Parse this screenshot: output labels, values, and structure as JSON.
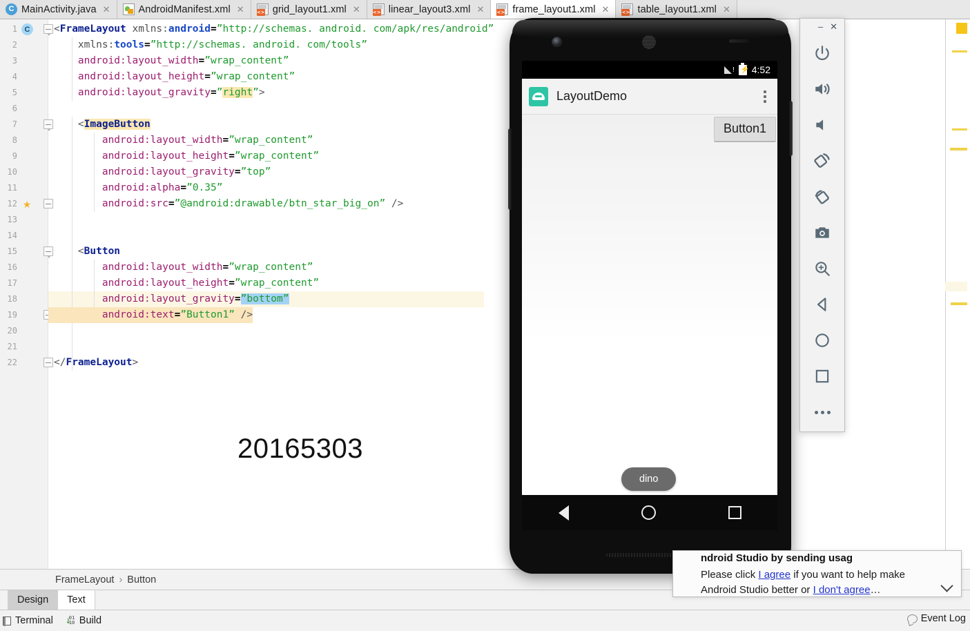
{
  "tabs": [
    {
      "label": "MainActivity.java",
      "icon": "java-class-icon",
      "active": false
    },
    {
      "label": "AndroidManifest.xml",
      "icon": "manifest-icon",
      "active": false
    },
    {
      "label": "grid_layout1.xml",
      "icon": "xml-layout-icon",
      "active": false
    },
    {
      "label": "linear_layout3.xml",
      "icon": "xml-layout-icon",
      "active": false
    },
    {
      "label": "frame_layout1.xml",
      "icon": "xml-layout-icon",
      "active": true
    },
    {
      "label": "table_layout1.xml",
      "icon": "xml-layout-icon",
      "active": false
    }
  ],
  "editor": {
    "line_count": 22,
    "current_line": 18,
    "selection_text": "bottom",
    "gutter_badge_line1": "C",
    "gutter_star_line": 12,
    "lines": [
      {
        "n": 1,
        "text": "<FrameLayout xmlns:android=\"http://schemas. android. com/apk/res/android\""
      },
      {
        "n": 2,
        "text": "    xmlns:tools=\"http://schemas. android. com/tools\""
      },
      {
        "n": 3,
        "text": "    android:layout_width=\"wrap_content\""
      },
      {
        "n": 4,
        "text": "    android:layout_height=\"wrap_content\""
      },
      {
        "n": 5,
        "text": "    android:layout_gravity=\"right\">"
      },
      {
        "n": 6,
        "text": ""
      },
      {
        "n": 7,
        "text": "    <ImageButton"
      },
      {
        "n": 8,
        "text": "        android:layout_width=\"wrap_content\""
      },
      {
        "n": 9,
        "text": "        android:layout_height=\"wrap_content\""
      },
      {
        "n": 10,
        "text": "        android:layout_gravity=\"top\""
      },
      {
        "n": 11,
        "text": "        android:alpha=\"0.35\""
      },
      {
        "n": 12,
        "text": "        android:src=\"@android:drawable/btn_star_big_on\" />"
      },
      {
        "n": 13,
        "text": ""
      },
      {
        "n": 14,
        "text": ""
      },
      {
        "n": 15,
        "text": "    <Button"
      },
      {
        "n": 16,
        "text": "        android:layout_width=\"wrap_content\""
      },
      {
        "n": 17,
        "text": "        android:layout_height=\"wrap_content\""
      },
      {
        "n": 18,
        "text": "        android:layout_gravity=\"bottom\""
      },
      {
        "n": 19,
        "text": "        android:text=\"Button1\" />"
      },
      {
        "n": 20,
        "text": ""
      },
      {
        "n": 21,
        "text": ""
      },
      {
        "n": 22,
        "text": "</FrameLayout>"
      }
    ],
    "watermark": "20165303"
  },
  "breadcrumb": {
    "items": [
      "FrameLayout",
      "Button"
    ],
    "separator": "›"
  },
  "mode_tabs": [
    {
      "label": "Design",
      "active": false
    },
    {
      "label": "Text",
      "active": true
    }
  ],
  "statusbar": {
    "terminal": "Terminal",
    "build": "Build",
    "event_log": "Event Log"
  },
  "emulator": {
    "window_controls": {
      "minimize": "–",
      "close": "✕"
    },
    "toolbar_icons": [
      "power-icon",
      "volume-up-icon",
      "volume-down-icon",
      "rotate-left-icon",
      "rotate-right-icon",
      "screenshot-camera-icon",
      "zoom-icon",
      "back-icon",
      "home-icon",
      "overview-icon",
      "more-icon"
    ],
    "status": {
      "time": "4:52",
      "signal": "signal-warning-icon",
      "battery": "battery-charging-icon"
    },
    "app": {
      "title": "LayoutDemo",
      "logo": "android-app-icon",
      "overflow": "kebab-menu-icon"
    },
    "content": {
      "image_button": "star-image-button",
      "image_button_alpha": "0.35",
      "button1_label": "Button1",
      "toast_text": "dino"
    },
    "navbar": [
      "back-triangle-icon",
      "home-circle-icon",
      "recents-square-icon"
    ]
  },
  "notification": {
    "title": "ndroid Studio by sending usag",
    "body_prefix": "Please click ",
    "link_agree": "I agree",
    "body_mid": " if you want to help make Android Studio better or ",
    "link_disagree": "I don't agree",
    "body_suffix": "…"
  },
  "colors": {
    "tag": "#0c1f8f",
    "attribute": "#9b1d6e",
    "string": "#1f9a2e",
    "namespace": "#1747c8",
    "current_line": "#fcf7e4",
    "selection": "#a3d2f5",
    "identifier_highlight": "#fbe7b0",
    "accent_marker": "#f5c518"
  }
}
